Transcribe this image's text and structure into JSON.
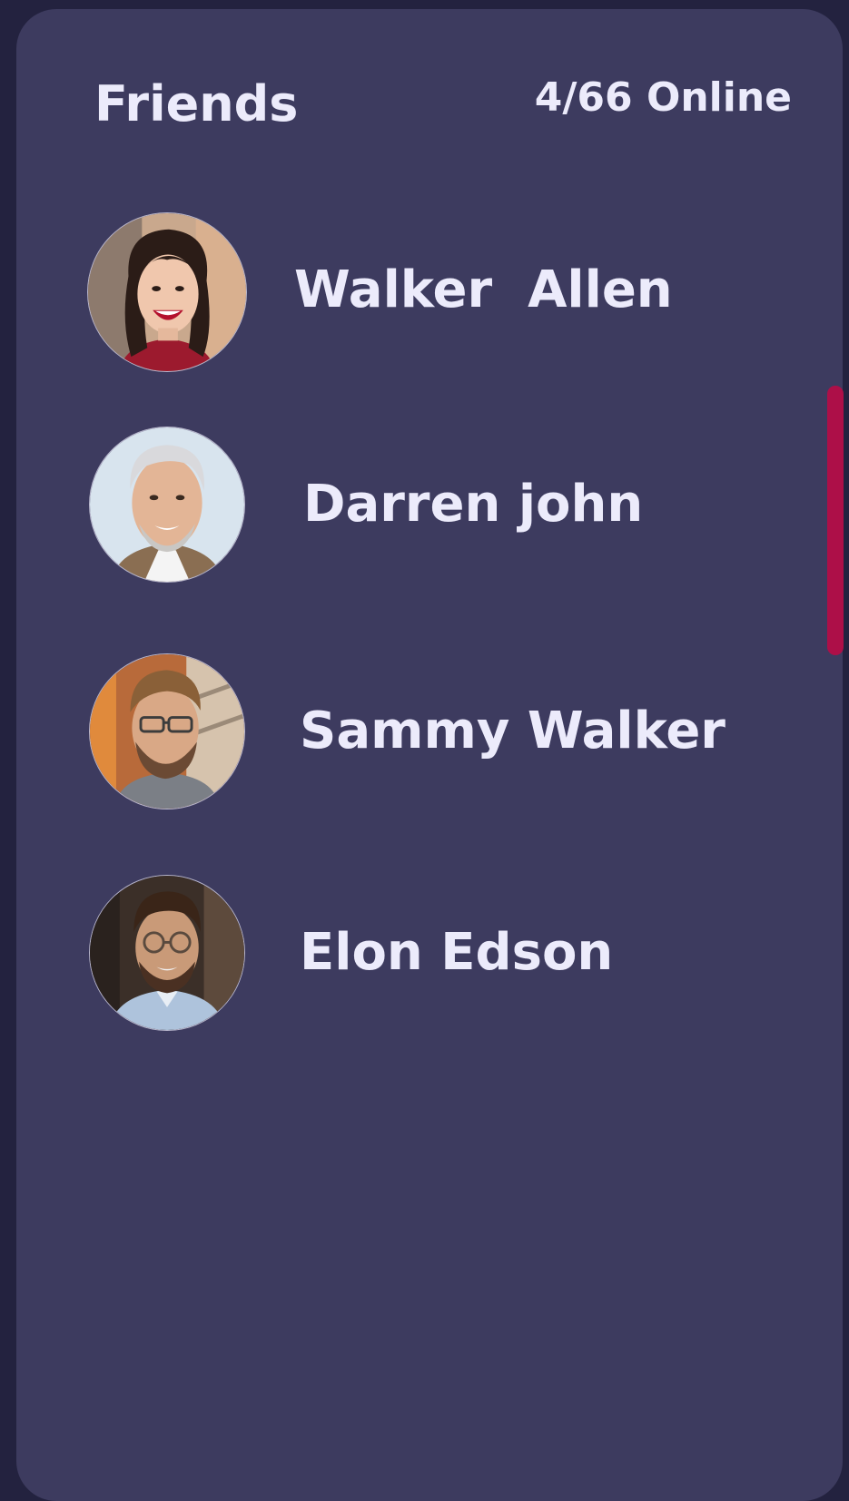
{
  "header": {
    "title": "Friends",
    "online_status": "4/66 Online"
  },
  "friends": [
    {
      "name": "Walker  Allen"
    },
    {
      "name": "Darren john"
    },
    {
      "name": "Sammy Walker"
    },
    {
      "name": "Elon Edson"
    }
  ],
  "colors": {
    "background": "#23223f",
    "panel": "#3d3b5f",
    "text": "#ecebfb",
    "scrollbar": "#ad0f48"
  }
}
